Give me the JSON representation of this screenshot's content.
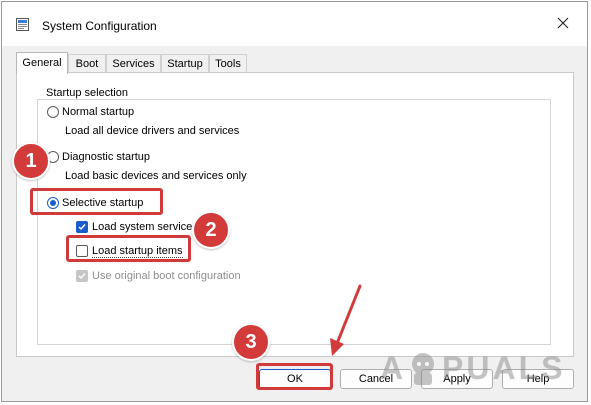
{
  "window": {
    "title": "System Configuration"
  },
  "tabs": [
    {
      "label": "General",
      "active": true
    },
    {
      "label": "Boot",
      "active": false
    },
    {
      "label": "Services",
      "active": false
    },
    {
      "label": "Startup",
      "active": false
    },
    {
      "label": "Tools",
      "active": false
    }
  ],
  "startup_selection": {
    "legend": "Startup selection",
    "normal": {
      "label": "Normal startup",
      "description": "Load all device drivers and services",
      "selected": false
    },
    "diagnostic": {
      "label": "Diagnostic startup",
      "description": "Load basic devices and services only",
      "selected": false
    },
    "selective": {
      "label": "Selective startup",
      "selected": true,
      "options": [
        {
          "label": "Load system services",
          "checked": true,
          "enabled": true
        },
        {
          "label": "Load startup items",
          "checked": false,
          "enabled": true
        },
        {
          "label": "Use original boot configuration",
          "checked": true,
          "enabled": false
        }
      ]
    }
  },
  "buttons": {
    "ok": "OK",
    "cancel": "Cancel",
    "apply": "Apply",
    "help": "Help"
  },
  "annotations": {
    "step1": "1",
    "step2": "2",
    "step3": "3",
    "highlight_color": "#d13a3a",
    "badge_color": "#d33b3b"
  },
  "watermark": {
    "text_left": "A",
    "text_right": "PUALS"
  },
  "icons": {
    "app": "system-configuration-icon",
    "close": "close-icon",
    "check": "check-icon",
    "arrow": "arrow-pointer-icon"
  },
  "colors": {
    "accent": "#1a5ccc",
    "window_bg": "#f0f0f0"
  }
}
